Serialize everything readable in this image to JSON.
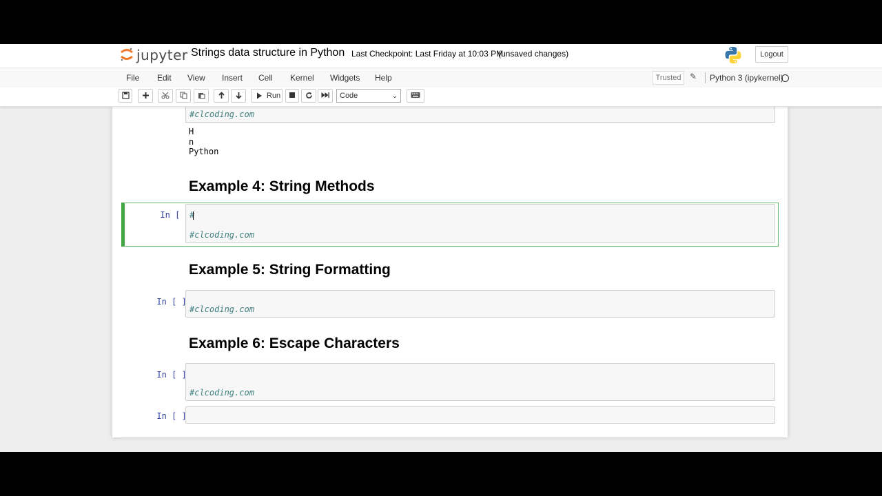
{
  "header": {
    "logo_text": "jupyter",
    "notebook_name": "Strings data structure in Python",
    "checkpoint": "Last Checkpoint: Last Friday at 10:03 PM",
    "unsaved": "(unsaved changes)",
    "logout": "Logout"
  },
  "menu": {
    "items": [
      "File",
      "Edit",
      "View",
      "Insert",
      "Cell",
      "Kernel",
      "Widgets",
      "Help"
    ],
    "trusted": "Trusted",
    "kernel": "Python 3 (ipykernel)"
  },
  "toolbar": {
    "run_label": "Run",
    "cell_type": "Code"
  },
  "notebook": {
    "prev_comment": "#clcoding.com",
    "outputs": [
      "H",
      "n",
      "Python"
    ],
    "sections": [
      {
        "heading": "Example 4: String Methods",
        "prompt": "In [ ]:",
        "first_line": "#",
        "comment": "#clcoding.com"
      },
      {
        "heading": "Example 5: String Formatting",
        "prompt": "In [ ]:",
        "comment": "#clcoding.com"
      },
      {
        "heading": "Example 6: Escape Characters",
        "prompt": "In [ ]:",
        "comment": "#clcoding.com"
      }
    ],
    "last_prompt": "In [ ]:"
  },
  "colors": {
    "selected_border": "#42a642",
    "comment": "#408080",
    "prompt": "#303f9f"
  }
}
